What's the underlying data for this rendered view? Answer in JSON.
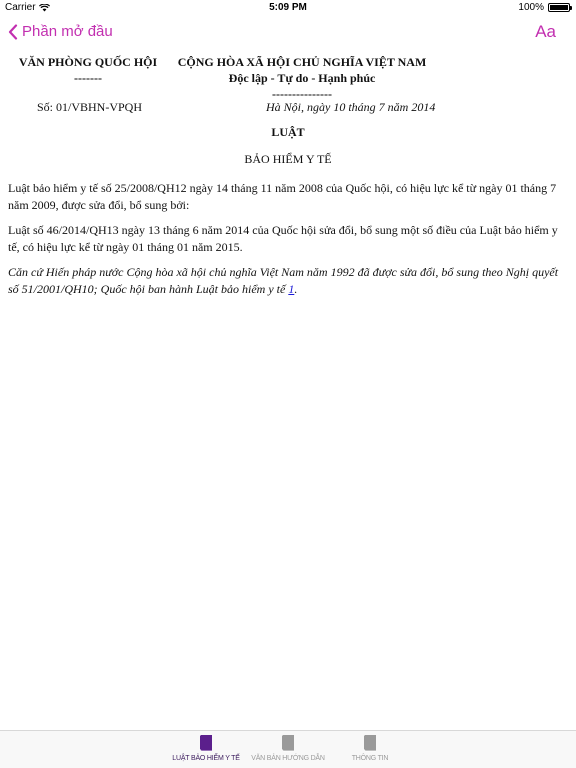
{
  "status_bar": {
    "carrier": "Carrier",
    "time": "5:09 PM",
    "battery": "100%",
    "battery_level": 1.0
  },
  "nav": {
    "back_label": "Phần mở đầu",
    "font_button": "Aa",
    "accent_color": "#c22fb0"
  },
  "document": {
    "org_left": "VĂN PHÒNG QUỐC HỘI",
    "org_left_sep": "-------",
    "org_right": "CỘNG HÒA XÃ HỘI CHỦ NGHĨA VIỆT NAM",
    "motto": "Độc lập - Tự do - Hạnh phúc",
    "motto_sep": "---------------",
    "number": "Số: 01/VBHN-VPQH",
    "date": "Hà Nội, ngày 10 tháng 7 năm 2014",
    "title": "LUẬT",
    "name": "BẢO HIỂM Y TẾ",
    "para1": "Luật bảo hiểm y tế số 25/2008/QH12 ngày 14 tháng 11 năm 2008 của Quốc hội, có hiệu lực kể từ ngày 01 tháng 7 năm 2009, được sửa đổi, bổ sung bởi:",
    "para2": "Luật số 46/2014/QH13 ngày 13 tháng 6 năm 2014 của Quốc hội sửa đổi, bổ sung một số điều của Luật bảo hiểm y tế, có hiệu lực kể từ ngày 01 tháng 01 năm 2015.",
    "para3": "Căn cứ Hiến pháp nước Cộng hòa xã hội chủ nghĩa Việt Nam năm 1992 đã được sửa đổi, bổ sung theo Nghị quyết số 51/2001/QH10; Quốc hội ban hành Luật bảo hiểm y tế ",
    "para3_link": "1",
    "para3_end": "."
  },
  "tabs": [
    {
      "label": "LUẬT BẢO HIỂM Y TẾ",
      "icon": "book-icon",
      "color": "#5b1f8c",
      "active": true
    },
    {
      "label": "VĂN BẢN HƯỚNG DẪN",
      "icon": "book-icon",
      "color": "#9a9a9a",
      "active": false
    },
    {
      "label": "THÔNG TIN",
      "icon": "book-icon",
      "color": "#9a9a9a",
      "active": false
    }
  ]
}
